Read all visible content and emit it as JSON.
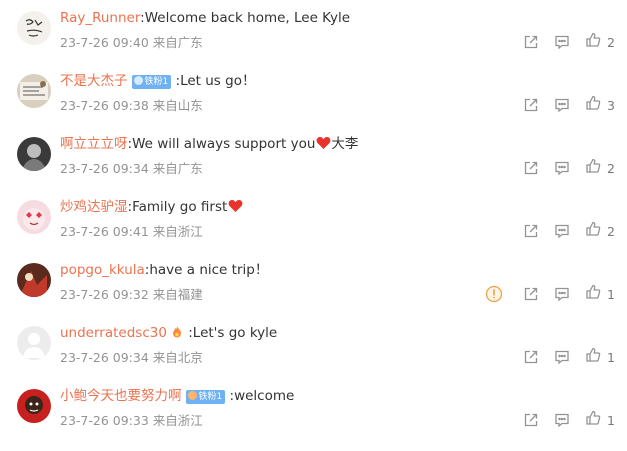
{
  "colors": {
    "username": "#eb7350",
    "meta": "#939393",
    "badge": "#6fb1f3",
    "warning": "#f0a24b"
  },
  "comments": [
    {
      "username": "Ray_Runner",
      "separator": ":",
      "text": "Welcome back home, Lee Kyle",
      "badge": "",
      "time": "23-7-26 09:40",
      "location": "来自广东",
      "likes": "2",
      "warning": false,
      "trailing_text": ""
    },
    {
      "username": "不是大杰子",
      "separator": " :",
      "text": "Let us go！",
      "badge": "铁粉1",
      "time": "23-7-26 09:38",
      "location": "来自山东",
      "likes": "3",
      "warning": false,
      "trailing_text": ""
    },
    {
      "username": "啊立立立呀",
      "separator": ":",
      "text": "We will always support you",
      "badge": "",
      "time": "23-7-26 09:34",
      "location": "来自广东",
      "likes": "2",
      "warning": false,
      "trailing_text": "大李"
    },
    {
      "username": "炒鸡达驴湿",
      "separator": ":",
      "text": "Family go first",
      "badge": "",
      "time": "23-7-26 09:41",
      "location": "来自浙江",
      "likes": "2",
      "warning": false,
      "trailing_text": ""
    },
    {
      "username": "popgo_kkula",
      "separator": ":",
      "text": "have a nice trip！",
      "badge": "",
      "time": "23-7-26 09:32",
      "location": "来自福建",
      "likes": "1",
      "warning": true,
      "trailing_text": ""
    },
    {
      "username": "underratedsc30",
      "separator": " :",
      "text": "Let's go kyle",
      "badge": "",
      "time": "23-7-26 09:34",
      "location": "来自北京",
      "likes": "1",
      "warning": false,
      "trailing_text": ""
    },
    {
      "username": "小鲍今天也要努力啊",
      "separator": " :",
      "text": "welcome",
      "badge": "铁粉1",
      "time": "23-7-26 09:33",
      "location": "来自浙江",
      "likes": "1",
      "warning": false,
      "trailing_text": ""
    }
  ],
  "icons": {
    "share": "share-icon",
    "comment": "comment-icon",
    "like": "thumbs-up-icon",
    "warning": "warning-icon"
  }
}
